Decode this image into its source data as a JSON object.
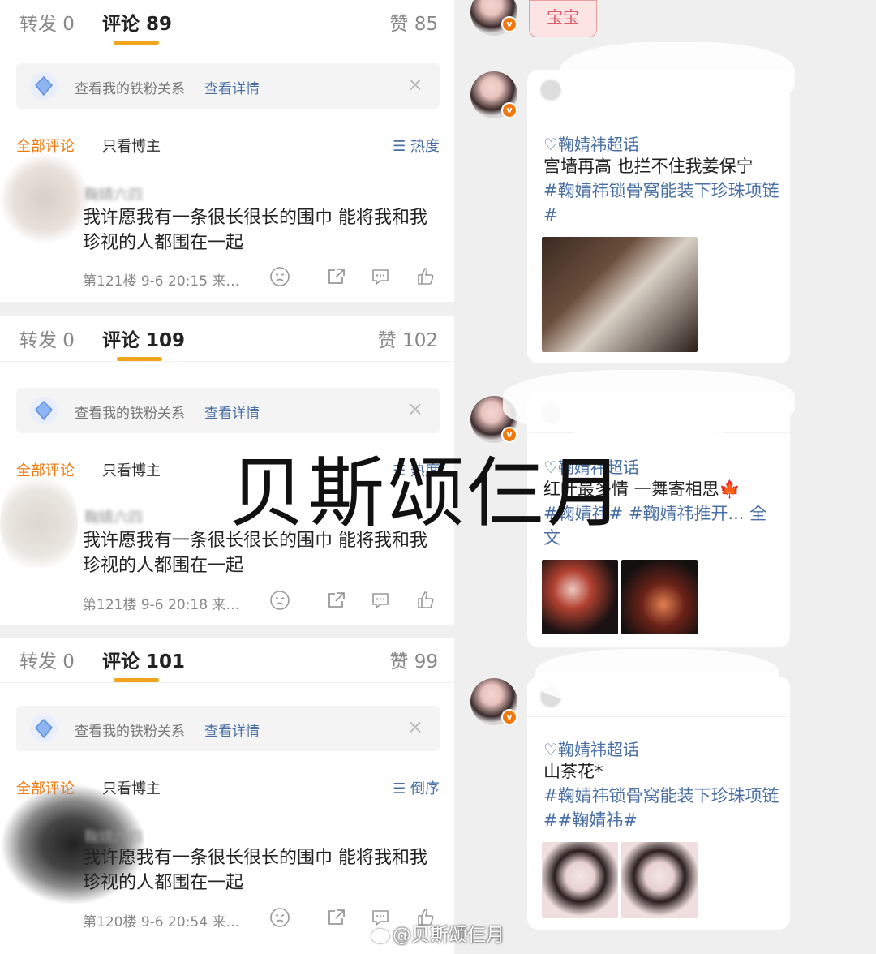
{
  "panels": [
    {
      "tabs": {
        "forward": "转发 0",
        "comments": "评论 89",
        "likes": "赞 85"
      },
      "fanbar": {
        "text": "查看我的铁粉关系",
        "link": "查看详情",
        "close": "×"
      },
      "filter": {
        "all": "全部评论",
        "only": "只看博主",
        "sort": "☰ 热度"
      },
      "comment": {
        "user": "鞠婧六四",
        "text": "我许愿我有一条很长很长的围巾 能将我和我珍视的人都围在一起",
        "meta": "第121楼  9-6 20:15  来…"
      }
    },
    {
      "tabs": {
        "forward": "转发 0",
        "comments": "评论 109",
        "likes": "赞 102"
      },
      "fanbar": {
        "text": "查看我的铁粉关系",
        "link": "查看详情",
        "close": "×"
      },
      "filter": {
        "all": "全部评论",
        "only": "只看博主",
        "sort": "☰ 热度"
      },
      "comment": {
        "user": "鞠婧六四",
        "text": "我许愿我有一条很长很长的围巾 能将我和我珍视的人都围在一起",
        "meta": "第121楼  9-6 20:18  来…"
      }
    },
    {
      "tabs": {
        "forward": "转发 0",
        "comments": "评论 101",
        "likes": "赞 99"
      },
      "fanbar": {
        "text": "查看我的铁粉关系",
        "link": "查看详情",
        "close": "×"
      },
      "filter": {
        "all": "全部评论",
        "only": "只看博主",
        "sort": "☰ 倒序"
      },
      "comment": {
        "user": "鞠婧六四",
        "text": "我许愿我有一条很长很长的围巾 能将我和我珍视的人都围在一起",
        "meta": "第120楼  9-6 20:54  来…"
      }
    }
  ],
  "chat": {
    "bubble": "宝宝",
    "cards": [
      {
        "topic": "♡鞠婧祎超话",
        "body": "宫墙再高 也拦不住我姜保宁",
        "tags": "#鞠婧祎锁骨窝能装下珍珠项链#"
      },
      {
        "topic": "♡鞠婧祎超话",
        "body": "红叶最多情 一舞寄相思🍁",
        "tags": "#鞠婧祎# #鞠婧祎推开... 全文"
      },
      {
        "topic": "♡鞠婧祎超话",
        "body": "山茶花*",
        "tags": "#鞠婧祎锁骨窝能装下珍珠项链##鞠婧祎#"
      }
    ]
  },
  "watermark": {
    "main": "贝斯颂仨月",
    "bottom": "@贝斯颂仨月"
  },
  "icons": [
    "gem-icon",
    "close-icon",
    "sort-icon",
    "dislike-icon",
    "share-icon",
    "reply-icon",
    "like-icon",
    "verified-icon"
  ],
  "colors": {
    "accent_orange": "#f2780c",
    "underline": "#f2a51c",
    "link_blue": "#4a6fa5"
  }
}
